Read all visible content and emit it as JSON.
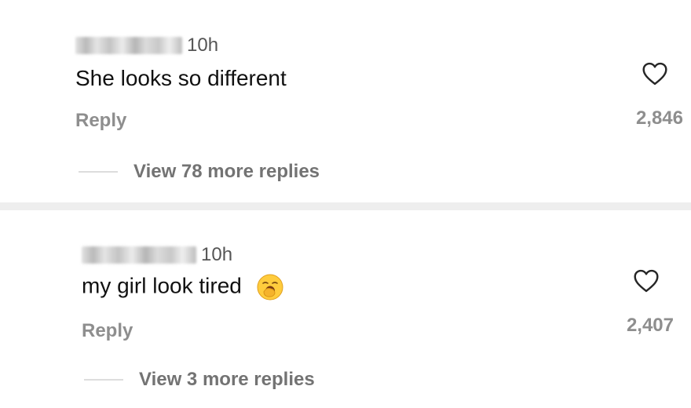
{
  "comments": [
    {
      "time": "10h",
      "text": "She looks so different",
      "reply_label": "Reply",
      "likes": "2,846",
      "view_more": "View 78 more replies"
    },
    {
      "time": "10h",
      "text": "my girl look tired",
      "emoji": "yawning-face-emoji",
      "reply_label": "Reply",
      "likes": "2,407",
      "view_more": "View 3 more replies"
    }
  ],
  "colors": {
    "text": "#111111",
    "secondary": "#8e8e8e",
    "divider": "#eeeeee"
  }
}
